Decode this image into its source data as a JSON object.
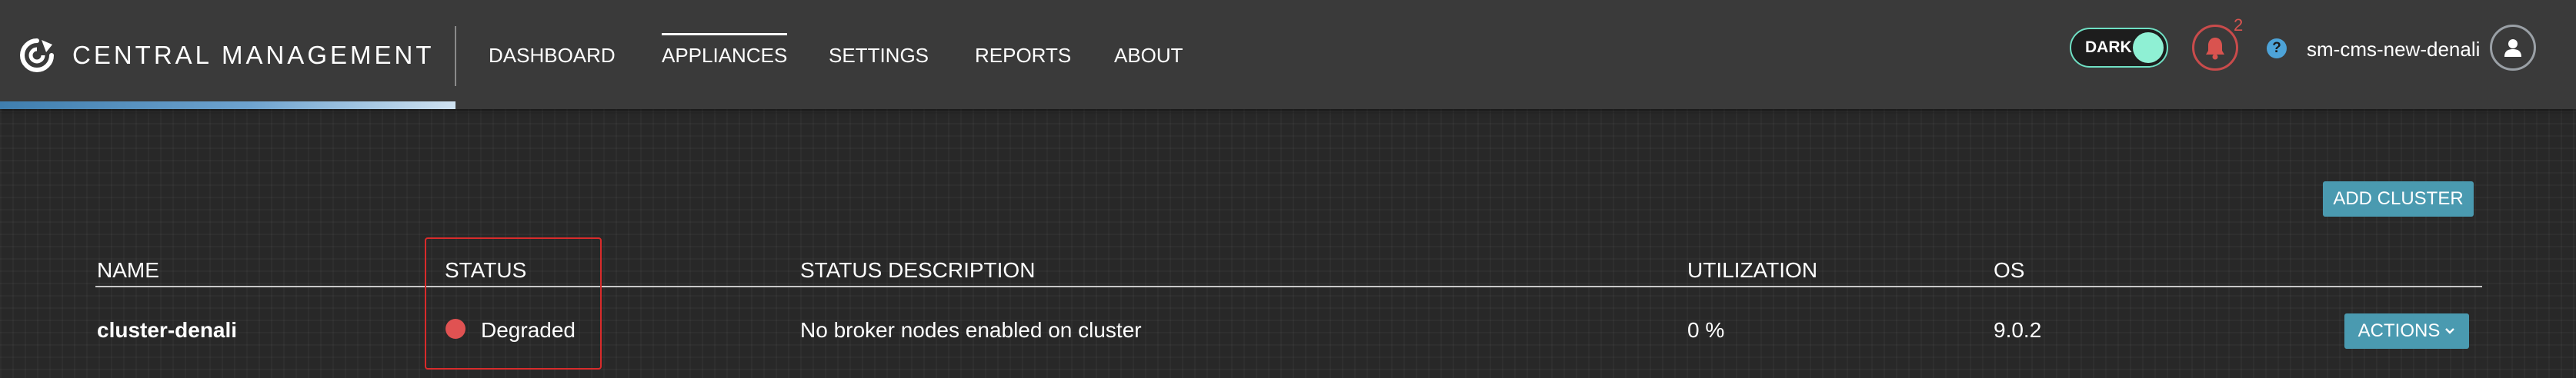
{
  "header": {
    "brand": "CENTRAL MANAGEMENT",
    "nav": [
      {
        "label": "DASHBOARD",
        "active": false
      },
      {
        "label": "APPLIANCES",
        "active": true
      },
      {
        "label": "SETTINGS",
        "active": false
      },
      {
        "label": "REPORTS",
        "active": false
      },
      {
        "label": "ABOUT",
        "active": false
      }
    ],
    "theme_toggle": {
      "label": "DARK",
      "state": "on"
    },
    "notifications": {
      "count": "2",
      "icon": "bell-icon"
    },
    "help": {
      "label": "?",
      "icon": "help-icon"
    },
    "username": "sm-cms-new-denali",
    "avatar_icon": "user-icon"
  },
  "toolbar": {
    "add_cluster_label": "ADD CLUSTER"
  },
  "table": {
    "columns": [
      "NAME",
      "STATUS",
      "STATUS DESCRIPTION",
      "UTILIZATION",
      "OS"
    ],
    "rows": [
      {
        "name": "cluster-denali",
        "status": "Degraded",
        "status_color": "#e05252",
        "status_description": "No broker nodes enabled on cluster",
        "utilization": "0 %",
        "os": "9.0.2",
        "actions_label": "ACTIONS"
      }
    ]
  },
  "colors": {
    "accent_button": "#4a9ab0",
    "toggle": "#8ff0d4",
    "alert": "#d9534f",
    "highlight_box": "#d92b2b"
  }
}
